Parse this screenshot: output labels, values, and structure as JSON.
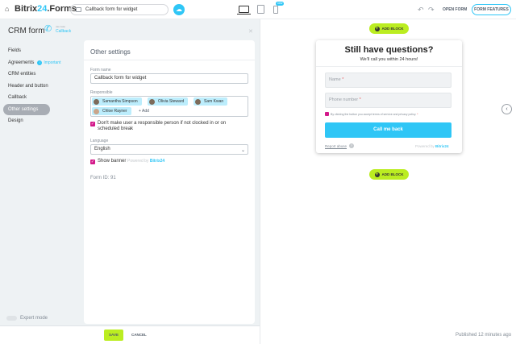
{
  "topbar": {
    "logo_main": "Bitrix",
    "logo_accent": "24",
    "logo_suffix": ".Forms",
    "form_name": "Callback form for widget",
    "new_badge": "new",
    "open_form": "OPEN FORM",
    "form_features": "FORM FEATURES"
  },
  "header": {
    "title": "CRM form",
    "small_label": "use case",
    "subtitle": "Callback"
  },
  "sidebar": {
    "items": [
      {
        "label": "Fields"
      },
      {
        "label": "Agreements",
        "badge": "Important"
      },
      {
        "label": "CRM entities"
      },
      {
        "label": "Header and button"
      },
      {
        "label": "Callback"
      },
      {
        "label": "Other settings"
      },
      {
        "label": "Design"
      }
    ],
    "active_index": 5,
    "expert_mode": "Expert mode"
  },
  "settings": {
    "title": "Other settings",
    "form_name_label": "Form name",
    "form_name_value": "Callback form for widget",
    "responsible_label": "Responsible",
    "responsible": [
      "Samantha Simpson",
      "Olivia Steward",
      "Sam Kwan",
      "Chloe Rayner"
    ],
    "add_label": "+ Add",
    "not_clocked_text": "Don't make user a responsible person if not clocked in or on scheduled break",
    "language_label": "Language",
    "language_value": "English",
    "show_banner_label": "Show banner",
    "powered_by": "Powered by",
    "powered_brand": "Bitrix24",
    "form_id": "Form ID: 91"
  },
  "bottombar": {
    "save": "SAVE",
    "cancel": "CANCEL",
    "published": "Published 12 minutes ago"
  },
  "preview": {
    "add_block": "ADD BLOCK",
    "title": "Still have questions?",
    "subtitle": "We'll call you within 24 hours!",
    "name_placeholder": "Name",
    "phone_placeholder": "Phone number",
    "required_mark": "*",
    "consent_text": "By clicking the button you accept terms of service and privacy policy.",
    "submit": "Call me back",
    "report_abuse": "Report abuse",
    "powered_by": "Powered by",
    "powered_brand": "Bitrix24"
  },
  "colors": {
    "accent": "#2fc6f6",
    "lime": "#bbed21",
    "checkbox": "#d3198a",
    "panel_bg": "#eef2f4"
  }
}
